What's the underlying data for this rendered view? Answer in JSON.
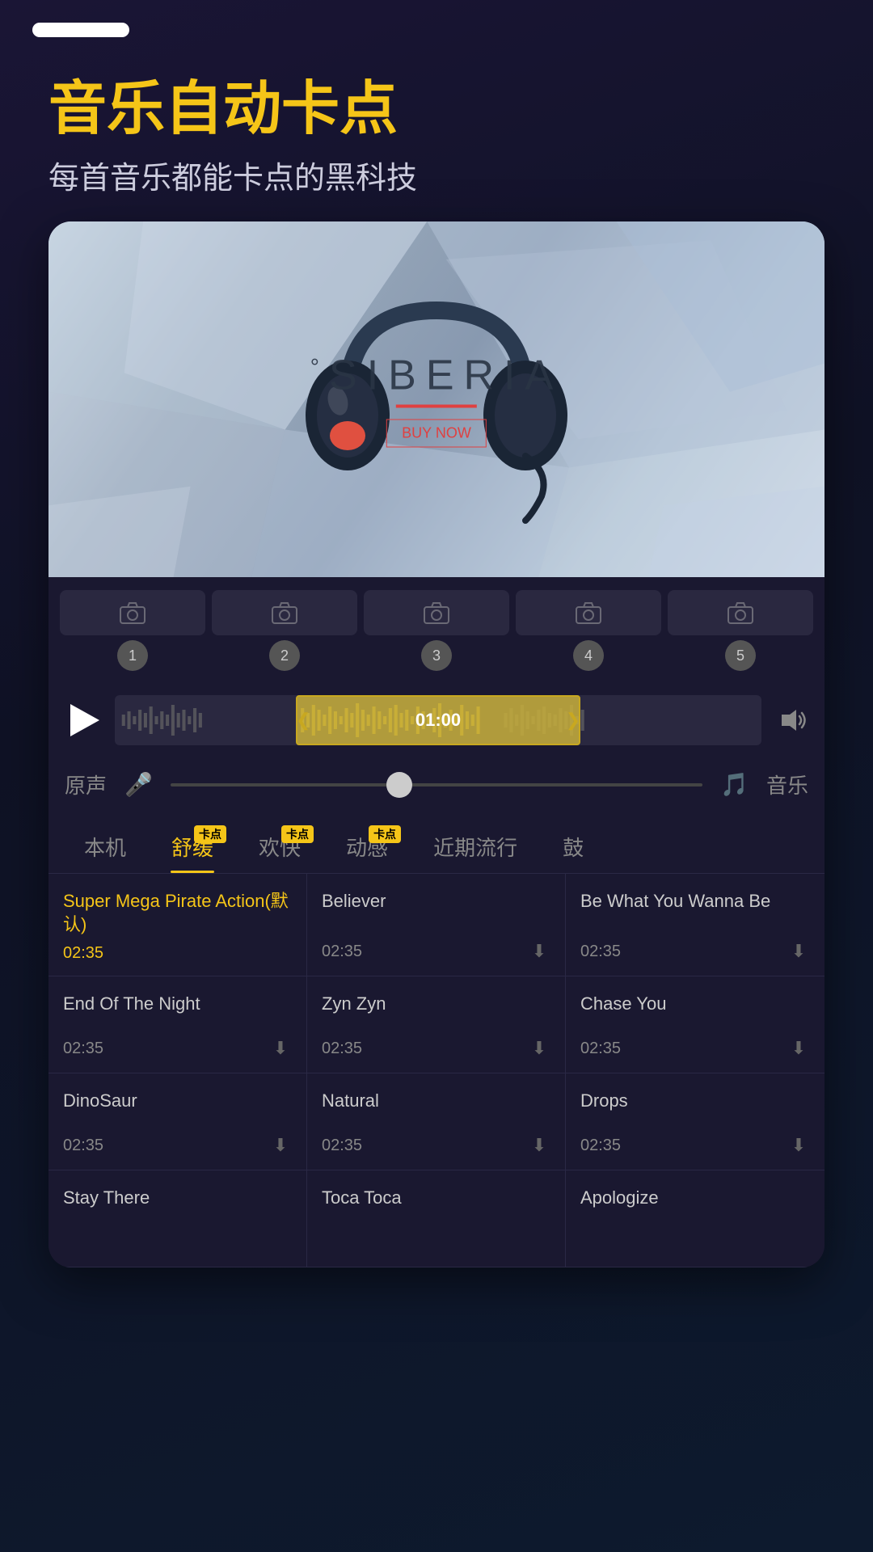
{
  "statusBar": {
    "pillVisible": true
  },
  "header": {
    "mainTitle": "音乐自动卡点",
    "subTitle": "每首音乐都能卡点的黑科技"
  },
  "hero": {
    "brandName": "°SIBERIA",
    "buyNow": "BUY NOW"
  },
  "thumbnails": [
    {
      "num": "1"
    },
    {
      "num": "2"
    },
    {
      "num": "3"
    },
    {
      "num": "4"
    },
    {
      "num": "5"
    }
  ],
  "player": {
    "timeLabel": "01:00"
  },
  "voiceMusic": {
    "voiceLabel": "原声",
    "musicLabel": "音乐"
  },
  "tabs": [
    {
      "label": "本机",
      "active": false,
      "badge": false
    },
    {
      "label": "舒缓",
      "active": true,
      "badge": true,
      "badgeText": "卡点"
    },
    {
      "label": "欢快",
      "active": false,
      "badge": true,
      "badgeText": "卡点"
    },
    {
      "label": "动感",
      "active": false,
      "badge": true,
      "badgeText": "卡点"
    },
    {
      "label": "近期流行",
      "active": false,
      "badge": false
    },
    {
      "label": "鼓",
      "active": false,
      "badge": false
    }
  ],
  "songs": [
    {
      "name": "Super Mega Pirate Action(默认)",
      "duration": "02:35",
      "active": true,
      "hasDownload": false
    },
    {
      "name": "Believer",
      "duration": "02:35",
      "active": false,
      "hasDownload": true
    },
    {
      "name": "Be What You Wanna Be",
      "duration": "02:35",
      "active": false,
      "hasDownload": true
    },
    {
      "name": "End Of The Night",
      "duration": "02:35",
      "active": false,
      "hasDownload": true
    },
    {
      "name": "Zyn Zyn",
      "duration": "02:35",
      "active": false,
      "hasDownload": true
    },
    {
      "name": "Chase You",
      "duration": "02:35",
      "active": false,
      "hasDownload": true
    },
    {
      "name": "DinoSaur",
      "duration": "02:35",
      "active": false,
      "hasDownload": true
    },
    {
      "name": "Natural",
      "duration": "02:35",
      "active": false,
      "hasDownload": true
    },
    {
      "name": "Drops",
      "duration": "02:35",
      "active": false,
      "hasDownload": true
    },
    {
      "name": "Stay There",
      "duration": "",
      "active": false,
      "hasDownload": false
    },
    {
      "name": "Toca Toca",
      "duration": "",
      "active": false,
      "hasDownload": false
    },
    {
      "name": "Apologize",
      "duration": "",
      "active": false,
      "hasDownload": false
    }
  ]
}
